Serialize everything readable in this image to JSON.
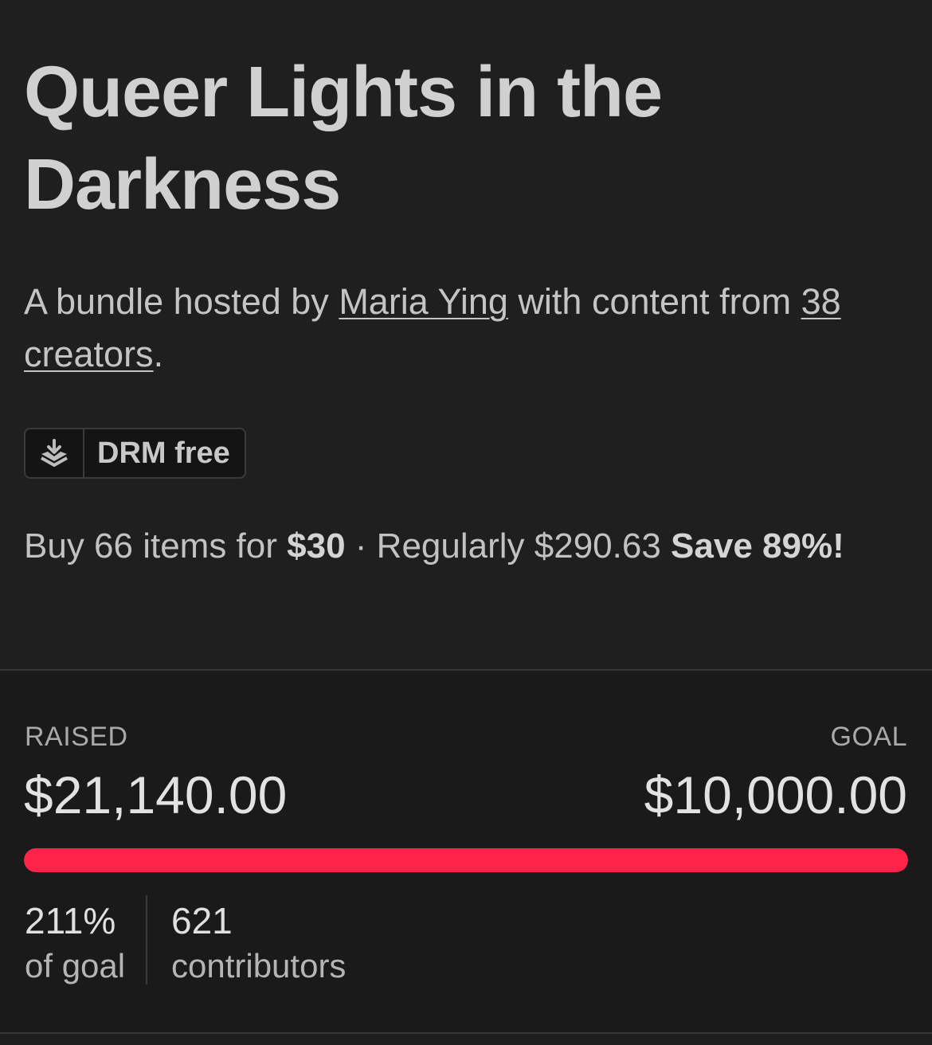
{
  "bundle": {
    "title": "Queer Lights in the Darkness",
    "byline": {
      "prefix": "A bundle hosted by ",
      "host": "Maria Ying",
      "middle": " with content from ",
      "creators_link": "38 creators",
      "suffix": "."
    },
    "drm_badge": {
      "icon": "download-tray-icon",
      "label": "DRM free"
    },
    "pricing": {
      "buy_prefix": "Buy 66 items for ",
      "price": "$30",
      "separator": " · ",
      "regularly": "Regularly $290.63 ",
      "save": "Save 89%!"
    }
  },
  "funding": {
    "raised_label": "RAISED",
    "raised_value": "$21,140.00",
    "goal_label": "GOAL",
    "goal_value": "$10,000.00",
    "progress_percent": 100,
    "progress_color": "#ff2349",
    "percent_value": "211%",
    "percent_caption": "of goal",
    "contributors_value": "621",
    "contributors_caption": "contributors"
  }
}
